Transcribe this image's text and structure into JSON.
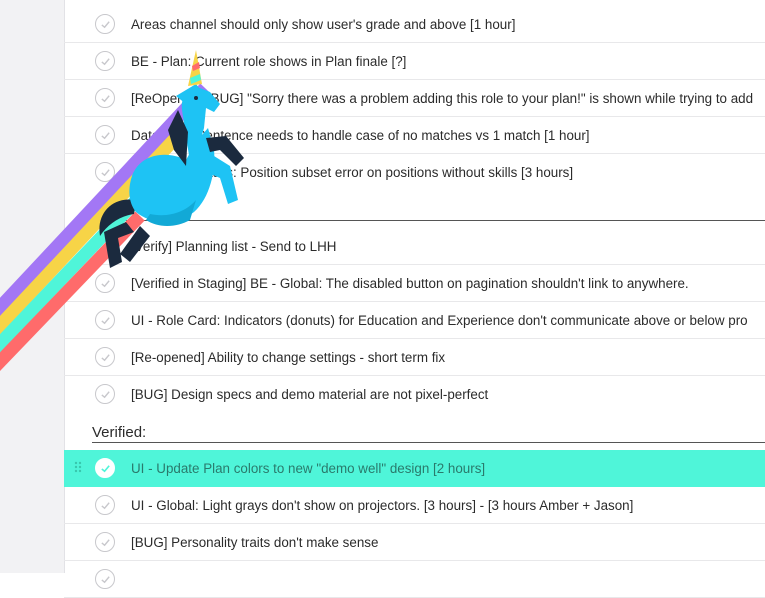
{
  "tasks_top": [
    {
      "label": "Areas channel should only show user's grade and above [1 hour]"
    },
    {
      "label": "BE - Plan: Current role shows in Plan finale [?]"
    },
    {
      "label": "[ReOpened] [BUG] \"Sorry there was a problem adding this role to your plan!\" is shown while trying to add"
    },
    {
      "label": "Data - BE: Sentence needs to handle case of no matches vs 1 match [1 hour]"
    },
    {
      "label": "BE - Role Details: Position subset error on positions without skills [3 hours]"
    }
  ],
  "section_middle": {
    "title": ""
  },
  "tasks_middle": [
    {
      "label": "[Verify] Planning list - Send to LHH"
    },
    {
      "label": "[Verified in Staging] BE - Global: The disabled button on pagination shouldn't link to anywhere."
    },
    {
      "label": "UI - Role Card: Indicators (donuts) for Education and Experience don't communicate above or below pro"
    },
    {
      "label": "[Re-opened] Ability to change settings - short term fix"
    },
    {
      "label": "[BUG] Design specs and demo material are not pixel-perfect"
    }
  ],
  "section_verified": {
    "title": "Verified:"
  },
  "tasks_verified": [
    {
      "label": "UI - Update Plan colors to new \"demo well\" design [2 hours]",
      "completed": true
    },
    {
      "label": "UI - Global: Light grays don't show on projectors. [3 hours] - [3 hours Amber + Jason]"
    },
    {
      "label": "[BUG] Personality traits don't make sense"
    }
  ],
  "colors": {
    "highlight": "#4ff5d9",
    "rainbow": [
      "#a377f5",
      "#f7d447",
      "#4ff5d9",
      "#ff6b6b"
    ],
    "unicorn_body": "#1ec3f4"
  },
  "icons": {
    "check": "check-icon",
    "drag": "drag-handle-icon",
    "celebration": "unicorn-icon"
  }
}
